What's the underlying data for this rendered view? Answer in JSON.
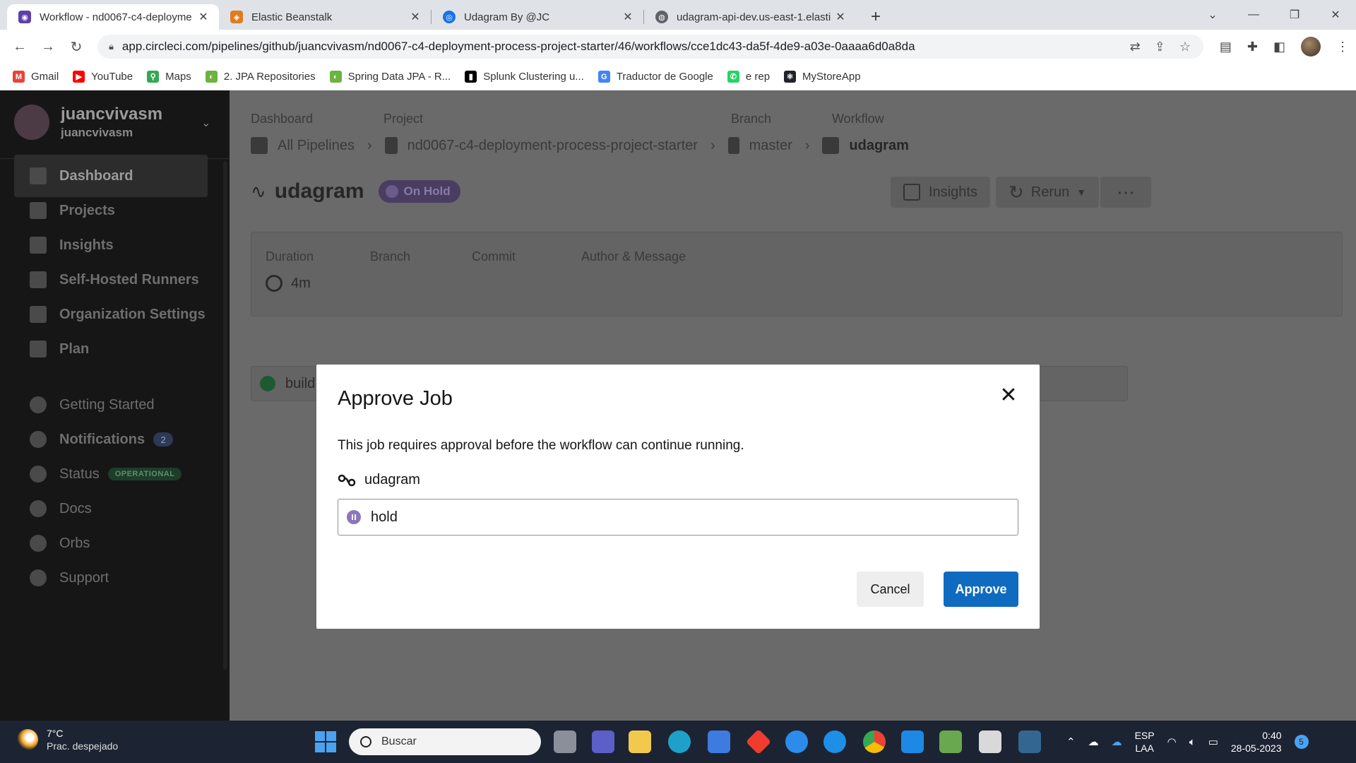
{
  "browser": {
    "tabs": [
      {
        "title": "Workflow - nd0067-c4-deployme",
        "active": true,
        "favicon": "circleci-icon",
        "color": "#5e3fa8"
      },
      {
        "title": "Elastic Beanstalk",
        "active": false,
        "favicon": "aws-icon",
        "color": "#e07c1c"
      },
      {
        "title": "Udagram By @JC",
        "active": false,
        "favicon": "react-icon",
        "color": "#1a73e8"
      },
      {
        "title": "udagram-api-dev.us-east-1.elasti",
        "active": false,
        "favicon": "globe-icon",
        "color": "#5f6368"
      }
    ],
    "url": "app.circleci.com/pipelines/github/juancvivasm/nd0067-c4-deployment-process-project-starter/46/workflows/cce1dc43-da5f-4de9-a03e-0aaaa6d0a8da",
    "bookmarks": [
      {
        "label": "Gmail",
        "color": "#ea4335",
        "glyph": "M"
      },
      {
        "label": "YouTube",
        "color": "#ff0000",
        "glyph": "▶"
      },
      {
        "label": "Maps",
        "color": "#34a853",
        "glyph": "⚲"
      },
      {
        "label": "2. JPA Repositories",
        "color": "#6db33f",
        "glyph": "◐"
      },
      {
        "label": "Spring Data JPA - R...",
        "color": "#6db33f",
        "glyph": "◐"
      },
      {
        "label": "Splunk Clustering u...",
        "color": "#000000",
        "glyph": "▮"
      },
      {
        "label": "Traductor de Google",
        "color": "#4285f4",
        "glyph": "G"
      },
      {
        "label": "e rep",
        "color": "#25d366",
        "glyph": "✆"
      },
      {
        "label": "MyStoreApp",
        "color": "#20232a",
        "glyph": "⚛"
      }
    ]
  },
  "sidebar": {
    "user_name": "juancvivasm",
    "user_sub": "juancvivasm",
    "items": [
      {
        "label": "Dashboard",
        "active": true,
        "icon": "dashboard-icon"
      },
      {
        "label": "Projects",
        "active": false,
        "icon": "projects-icon"
      },
      {
        "label": "Insights",
        "active": false,
        "icon": "insights-icon"
      },
      {
        "label": "Self-Hosted Runners",
        "active": false,
        "icon": "runners-icon"
      },
      {
        "label": "Organization Settings",
        "active": false,
        "icon": "gear-icon"
      },
      {
        "label": "Plan",
        "active": false,
        "icon": "plan-icon"
      }
    ],
    "bottom_items": [
      {
        "label": "Getting Started",
        "icon": "rocket-icon"
      },
      {
        "label": "Notifications",
        "icon": "bell-icon",
        "count": "2"
      },
      {
        "label": "Status",
        "icon": "status-icon",
        "badge": "OPERATIONAL"
      },
      {
        "label": "Docs",
        "icon": "docs-icon"
      },
      {
        "label": "Orbs",
        "icon": "orbs-icon"
      },
      {
        "label": "Support",
        "icon": "help-icon"
      }
    ]
  },
  "breadcrumb": {
    "labels": [
      "Dashboard",
      "Project",
      "Branch",
      "Workflow"
    ],
    "pipelines": "All Pipelines",
    "project": "nd0067-c4-deployment-process-project-starter",
    "branch": "master",
    "workflow": "udagram"
  },
  "workflow": {
    "title": "udagram",
    "status": "On Hold",
    "insights_label": "Insights",
    "rerun_label": "Rerun",
    "info_headers": [
      "Duration",
      "Branch",
      "Commit",
      "Author & Message"
    ],
    "duration": "4m",
    "job": "build"
  },
  "modal": {
    "title": "Approve Job",
    "description": "This job requires approval before the workflow can continue running.",
    "workflow_name": "udagram",
    "job_name": "hold",
    "cancel_label": "Cancel",
    "approve_label": "Approve"
  },
  "taskbar": {
    "temperature": "7°C",
    "weather": "Prac. despejado",
    "search_placeholder": "Buscar",
    "lang_1": "ESP",
    "lang_2": "LAA",
    "time": "0:40",
    "date": "28-05-2023",
    "notification_count": "5"
  }
}
